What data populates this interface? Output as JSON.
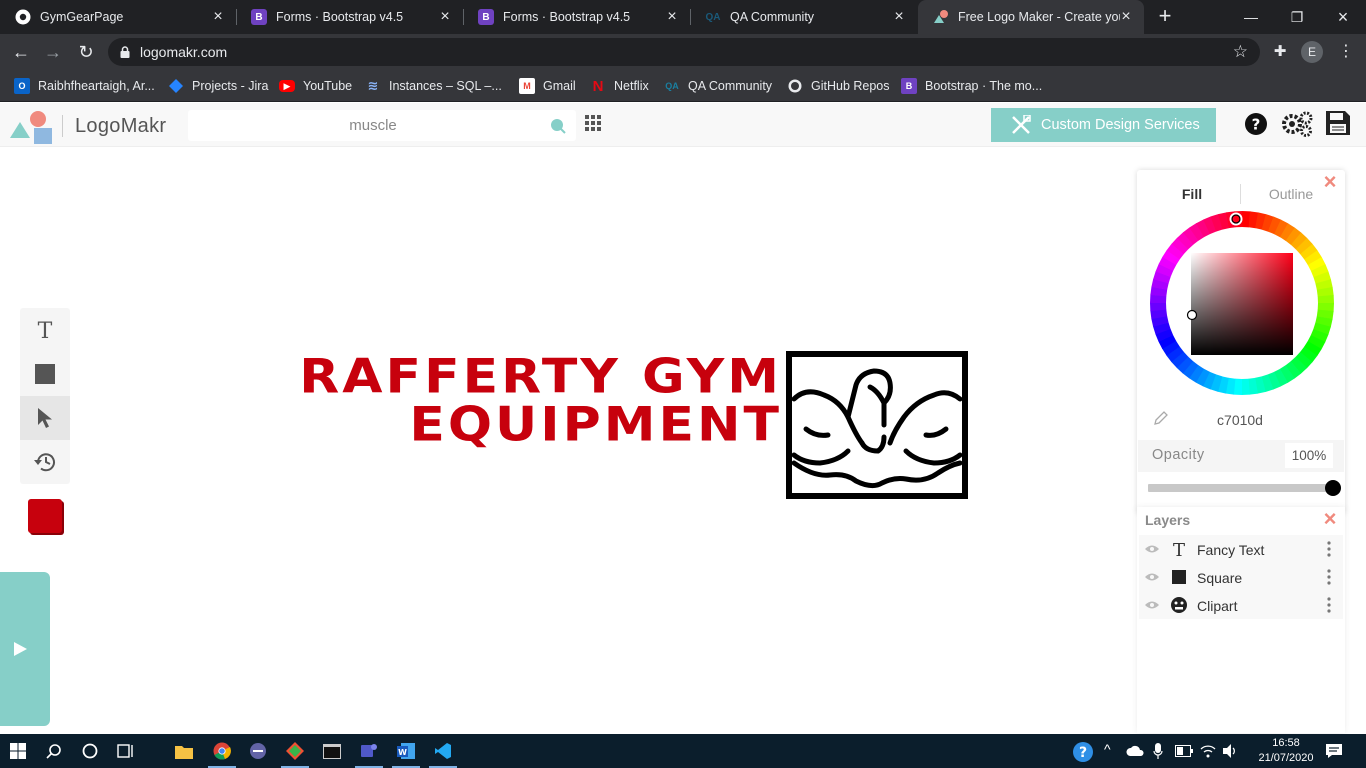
{
  "browser": {
    "tabs": [
      {
        "label": "GymGearPage",
        "favicon": "chrome-icon",
        "active": false
      },
      {
        "label": "Forms · Bootstrap v4.5",
        "favicon": "bootstrap-icon",
        "active": false
      },
      {
        "label": "Forms · Bootstrap v4.5",
        "favicon": "bootstrap-icon",
        "active": false
      },
      {
        "label": "QA Community",
        "favicon": "qa-icon",
        "active": false
      },
      {
        "label": "Free Logo Maker - Create your",
        "favicon": "logomakr-icon",
        "active": true
      }
    ],
    "url": "logomakr.com",
    "profile_initial": "E",
    "bookmarks": [
      {
        "label": "Raibhfheartaigh, Ar...",
        "icon": "outlook-icon"
      },
      {
        "label": "Projects - Jira",
        "icon": "jira-icon"
      },
      {
        "label": "YouTube",
        "icon": "youtube-icon"
      },
      {
        "label": "Instances – SQL –...",
        "icon": "sql-icon"
      },
      {
        "label": "Gmail",
        "icon": "gmail-icon"
      },
      {
        "label": "Netflix",
        "icon": "netflix-icon"
      },
      {
        "label": "QA Community",
        "icon": "qa-icon"
      },
      {
        "label": "GitHub Repos",
        "icon": "github-icon"
      },
      {
        "label": "Bootstrap · The mo...",
        "icon": "bootstrap-icon"
      }
    ]
  },
  "app": {
    "name": "LogoMakr",
    "search_value": "muscle",
    "custom_design_label": "Custom Design Services",
    "accent_color": "#86cfc8"
  },
  "canvas": {
    "text_line1": "RAFFERTY GYM",
    "text_line2": "EQUIPMENT",
    "text_color": "#c7010d",
    "selected_color": "#c7010d"
  },
  "color_panel": {
    "tab_fill": "Fill",
    "tab_outline": "Outline",
    "hex": "c7010d",
    "opacity_label": "Opacity",
    "opacity_value": "100%",
    "opacity": 1.0
  },
  "layers": {
    "title": "Layers",
    "items": [
      {
        "name": "Fancy Text",
        "type_icon": "text-icon"
      },
      {
        "name": "Square",
        "type_icon": "square-icon"
      },
      {
        "name": "Clipart",
        "type_icon": "clipart-icon"
      }
    ]
  },
  "taskbar": {
    "time": "16:58",
    "date": "21/07/2020"
  }
}
